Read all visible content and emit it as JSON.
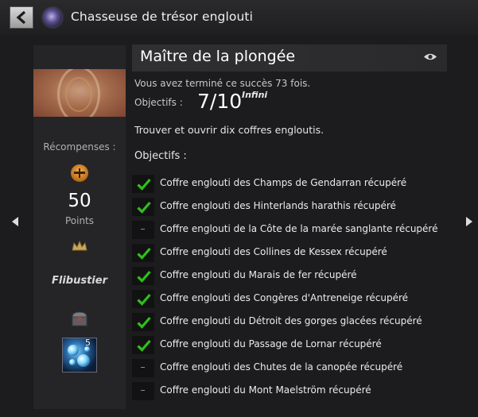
{
  "header": {
    "back_icon": "chevron-left-icon",
    "category_icon": "category-emblem-icon",
    "category_title": "Chasseuse de trésor englouti"
  },
  "sidebar": {
    "image_icon": "achievement-image",
    "rewards_label": "Récompenses :",
    "points_icon": "achievement-points-icon",
    "points_value": "50",
    "points_label": "Points",
    "title_icon": "crown-icon",
    "title_reward": "Flibustier",
    "chest_icon": "chest-icon",
    "reward_item_icon": "bubble-orb-item-icon",
    "reward_count": "5"
  },
  "navigation": {
    "previous_icon": "arrow-left-icon",
    "next_icon": "arrow-right-icon"
  },
  "achievement": {
    "title": "Maître de la plongée",
    "watch_icon": "eye-icon",
    "completed_text": "Vous avez terminé ce succès 73 fois.",
    "objective_label": "Objectifs :",
    "objective_count": "7/10",
    "objective_sup": "Infini",
    "description": "Trouver et ouvrir dix coffres engloutis.",
    "objectives_heading": "Objectifs :",
    "objectives": [
      {
        "text": "Coffre englouti des Champs de Gendarran récupéré",
        "done": true
      },
      {
        "text": "Coffre englouti des Hinterlands harathis récupéré",
        "done": true
      },
      {
        "text": "Coffre englouti de la Côte de la marée sanglante récupéré",
        "done": false
      },
      {
        "text": "Coffre englouti des Collines de Kessex récupéré",
        "done": true
      },
      {
        "text": "Coffre englouti du Marais de fer récupéré",
        "done": true
      },
      {
        "text": "Coffre englouti des Congères d'Antreneige récupéré",
        "done": true
      },
      {
        "text": "Coffre englouti du Détroit des gorges glacées récupéré",
        "done": true
      },
      {
        "text": "Coffre englouti du Passage de Lornar récupéré",
        "done": true
      },
      {
        "text": "Coffre englouti des Chutes de la canopée récupéré",
        "done": false
      },
      {
        "text": "Coffre englouti du Mont Maelström récupéré",
        "done": false
      }
    ]
  },
  "colors": {
    "check": "#2fc01a",
    "background": "#1c1c1e",
    "panel": "#252527"
  }
}
